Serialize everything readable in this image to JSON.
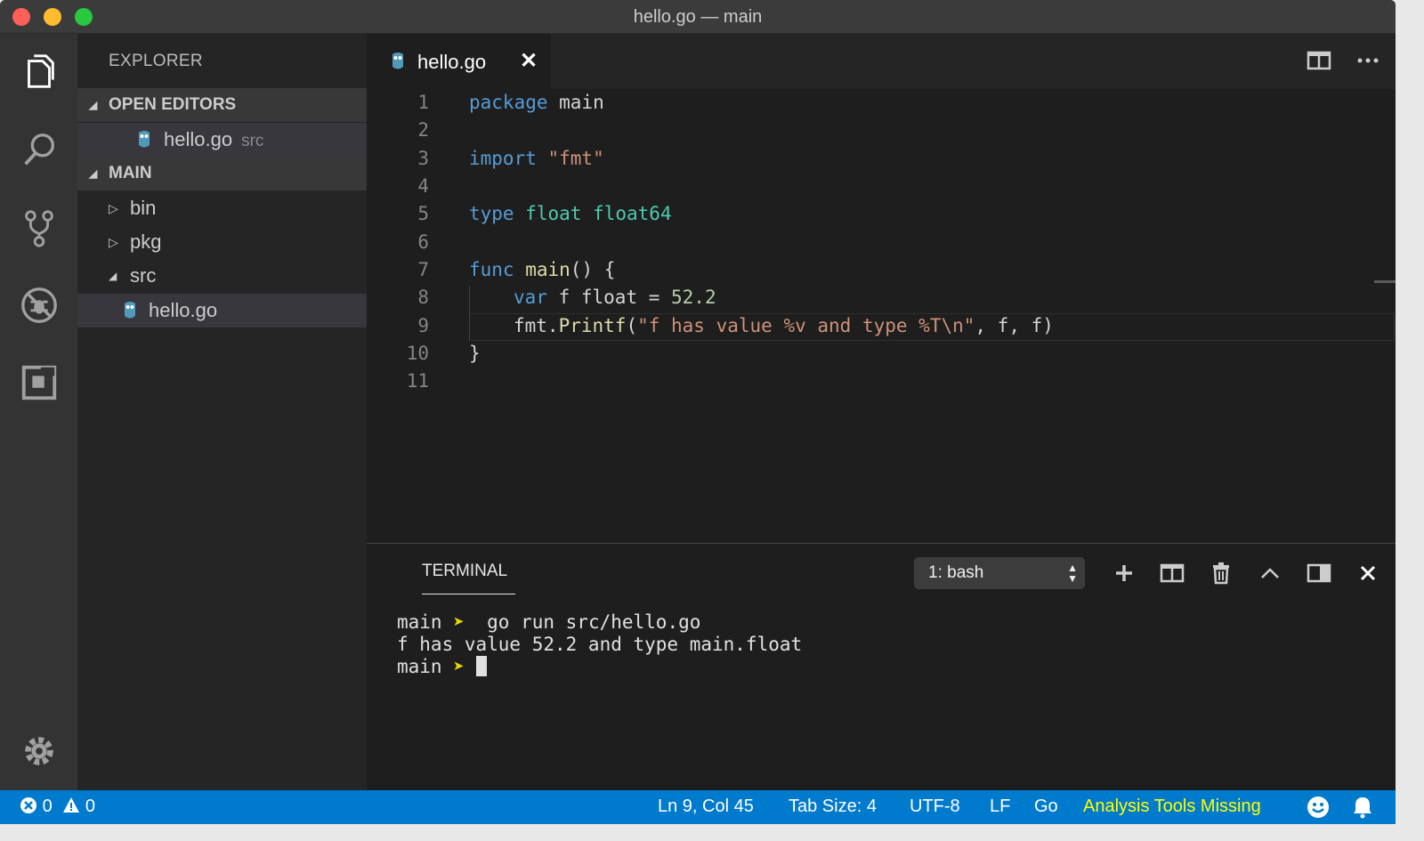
{
  "window": {
    "title": "hello.go — main"
  },
  "activity_bar": {
    "items": [
      {
        "name": "explorer-icon"
      },
      {
        "name": "search-icon"
      },
      {
        "name": "source-control-icon"
      },
      {
        "name": "debug-icon"
      },
      {
        "name": "extensions-icon"
      },
      {
        "name": "gear-icon"
      }
    ]
  },
  "sidebar": {
    "title": "EXPLORER",
    "open_editors": {
      "header": "OPEN EDITORS",
      "items": [
        {
          "name": "hello.go",
          "description": "src"
        }
      ]
    },
    "folder": {
      "header": "MAIN",
      "items": [
        {
          "name": "bin"
        },
        {
          "name": "pkg"
        },
        {
          "name": "src"
        },
        {
          "name": "hello.go"
        }
      ]
    }
  },
  "editor": {
    "tab": {
      "label": "hello.go",
      "close": "✕"
    },
    "line_numbers": [
      "1",
      "2",
      "3",
      "4",
      "5",
      "6",
      "7",
      "8",
      "9",
      "10",
      "11"
    ],
    "tokens": {
      "l1_kw": "package",
      "l1_id": " main",
      "l3_kw": "import",
      "l3_str": " \"fmt\"",
      "l5_kw": "type",
      "l5_ty1": " float",
      "l5_ty2": " float64",
      "l7_kw": "func",
      "l7_fn": " main",
      "l7_rest": "() {",
      "l8_kw": "var",
      "l8_mid": " f float = ",
      "l8_num": "52.2",
      "l9_obj": "fmt.",
      "l9_fn": "Printf",
      "l9_open": "(",
      "l9_str": "\"f has value %v and type %T\\n\"",
      "l9_rest": ", f, f)",
      "l10": "}"
    }
  },
  "panel": {
    "tab": "TERMINAL",
    "terminal_select": "1: bash",
    "lines": {
      "p1_dir": "main",
      "p1_arrow": " ➤ ",
      "p1_cmd": " go run src/hello.go",
      "out": "f has value 52.2 and type main.float",
      "p2_dir": "main",
      "p2_arrow": " ➤ "
    }
  },
  "status_bar": {
    "errors": "0",
    "warnings": "0",
    "position": "Ln 9, Col 45",
    "tab_size": "Tab Size: 4",
    "encoding": "UTF-8",
    "eol": "LF",
    "language": "Go",
    "analysis": "Analysis Tools Missing",
    "colors": {
      "background": "#007acc",
      "analysis": "#ffff00"
    }
  }
}
